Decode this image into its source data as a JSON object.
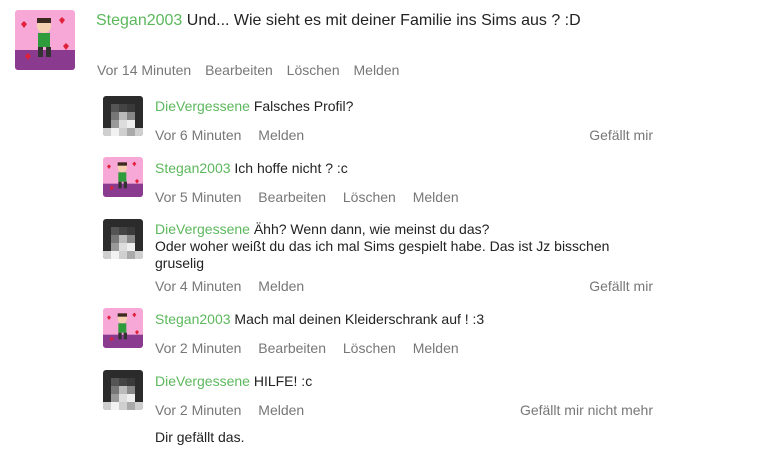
{
  "main_post": {
    "author": "Stegan2003",
    "text": "Und... Wie sieht es mit deiner Familie ins Sims aus ? :D",
    "time": "Vor 14 Minuten",
    "edit": "Bearbeiten",
    "delete": "Löschen",
    "report": "Melden"
  },
  "replies": [
    {
      "author": "DieVergessene",
      "text": "Falsches Profil?",
      "time": "Vor 6 Minuten",
      "report": "Melden",
      "like": "Gefällt mir"
    },
    {
      "author": "Stegan2003",
      "text": "Ich hoffe nicht ? :c",
      "time": "Vor 5 Minuten",
      "edit": "Bearbeiten",
      "delete": "Löschen",
      "report": "Melden"
    },
    {
      "author": "DieVergessene",
      "text": "Ähh? Wenn dann, wie meinst du das?",
      "text2": "Oder woher weißt du das ich mal Sims gespielt habe. Das ist Jz bisschen",
      "text3": "gruselig",
      "time": "Vor 4 Minuten",
      "report": "Melden",
      "like": "Gefällt mir"
    },
    {
      "author": "Stegan2003",
      "text": "Mach mal deinen Kleiderschrank auf ! :3",
      "time": "Vor 2 Minuten",
      "edit": "Bearbeiten",
      "delete": "Löschen",
      "report": "Melden"
    },
    {
      "author": "DieVergessene",
      "text": "HILFE! :c",
      "time": "Vor 2 Minuten",
      "report": "Melden",
      "like": "Gefällt mir nicht mehr",
      "liked_note": "Dir gefällt das."
    }
  ]
}
